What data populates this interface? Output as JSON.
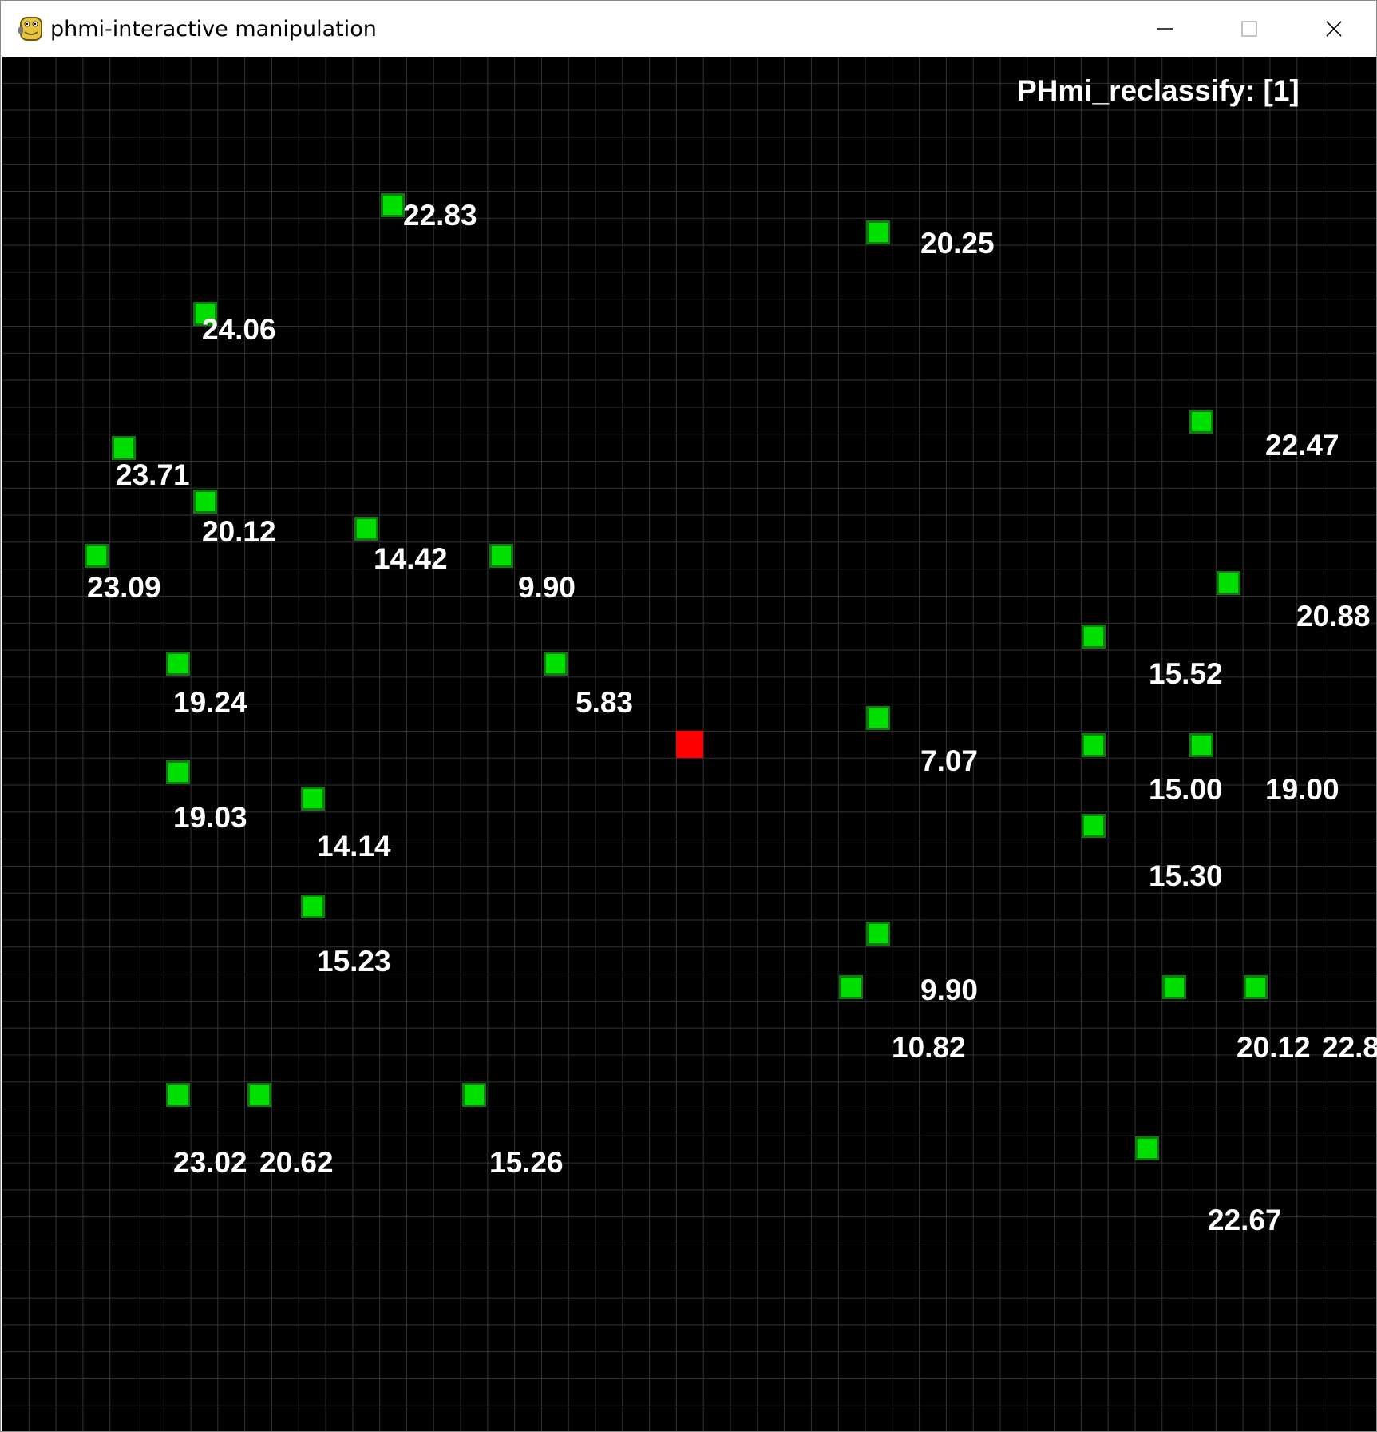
{
  "window": {
    "title": "phmi-interactive manipulation",
    "icon": "python-snake-icon",
    "controls": [
      "minimize-icon",
      "maximize-icon",
      "close-icon"
    ]
  },
  "canvas": {
    "background": "#000000",
    "grid_color": "#333333",
    "mode_label": "PHmi_reclassify: [1]"
  },
  "nodes": [
    {
      "label": "22.83",
      "color": "#00e000"
    },
    {
      "label": "20.25",
      "color": "#00e000"
    },
    {
      "label": "24.06",
      "color": "#00e000"
    },
    {
      "label": "22.47",
      "color": "#00e000"
    },
    {
      "label": "23.71",
      "color": "#00e000"
    },
    {
      "label": "20.12",
      "color": "#00e000"
    },
    {
      "label": "14.42",
      "color": "#00e000"
    },
    {
      "label": "9.90",
      "color": "#00e000"
    },
    {
      "label": "23.09",
      "color": "#00e000"
    },
    {
      "label": "20.88",
      "color": "#00e000"
    },
    {
      "label": "15.52",
      "color": "#00e000"
    },
    {
      "label": "19.24",
      "color": "#00e000"
    },
    {
      "label": "5.83",
      "color": "#00e000"
    },
    {
      "label": "7.07",
      "color": "#00e000"
    },
    {
      "label": "15.00",
      "color": "#00e000"
    },
    {
      "label": "19.00",
      "color": "#00e000"
    },
    {
      "label": "19.03",
      "color": "#00e000"
    },
    {
      "label": "14.14",
      "color": "#00e000"
    },
    {
      "label": "15.30",
      "color": "#00e000"
    },
    {
      "label": "15.23",
      "color": "#00e000"
    },
    {
      "label": "9.90",
      "color": "#00e000"
    },
    {
      "label": "10.82",
      "color": "#00e000"
    },
    {
      "label": "20.12",
      "color": "#00e000"
    },
    {
      "label": "22.8",
      "color": "#00e000"
    },
    {
      "label": "23.02",
      "color": "#00e000"
    },
    {
      "label": "20.62",
      "color": "#00e000"
    },
    {
      "label": "15.26",
      "color": "#00e000"
    },
    {
      "label": "22.67",
      "color": "#00e000"
    }
  ],
  "selected_node": {
    "color": "#ff0000"
  }
}
